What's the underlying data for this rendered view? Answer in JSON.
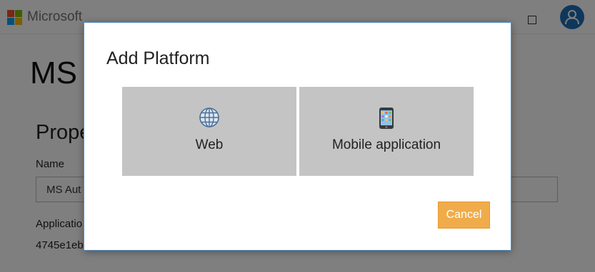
{
  "header": {
    "brand": "Microsoft",
    "logo_colors": [
      "#f25022",
      "#7fba00",
      "#00a4ef",
      "#ffb900"
    ]
  },
  "background_page": {
    "title": "MS",
    "section_heading": "Prope",
    "name_label": "Name",
    "name_value": "MS Aut",
    "app_label": "Applicatio",
    "app_id": "4745e1eb"
  },
  "dialog": {
    "title": "Add Platform",
    "options": [
      {
        "label": "Web",
        "icon": "globe-icon"
      },
      {
        "label": "Mobile application",
        "icon": "mobile-phone-icon"
      }
    ],
    "cancel_label": "Cancel"
  },
  "colors": {
    "accent_button": "#f0ac4a",
    "tile_background": "#c4c4c4",
    "avatar": "#1f6fb7"
  }
}
